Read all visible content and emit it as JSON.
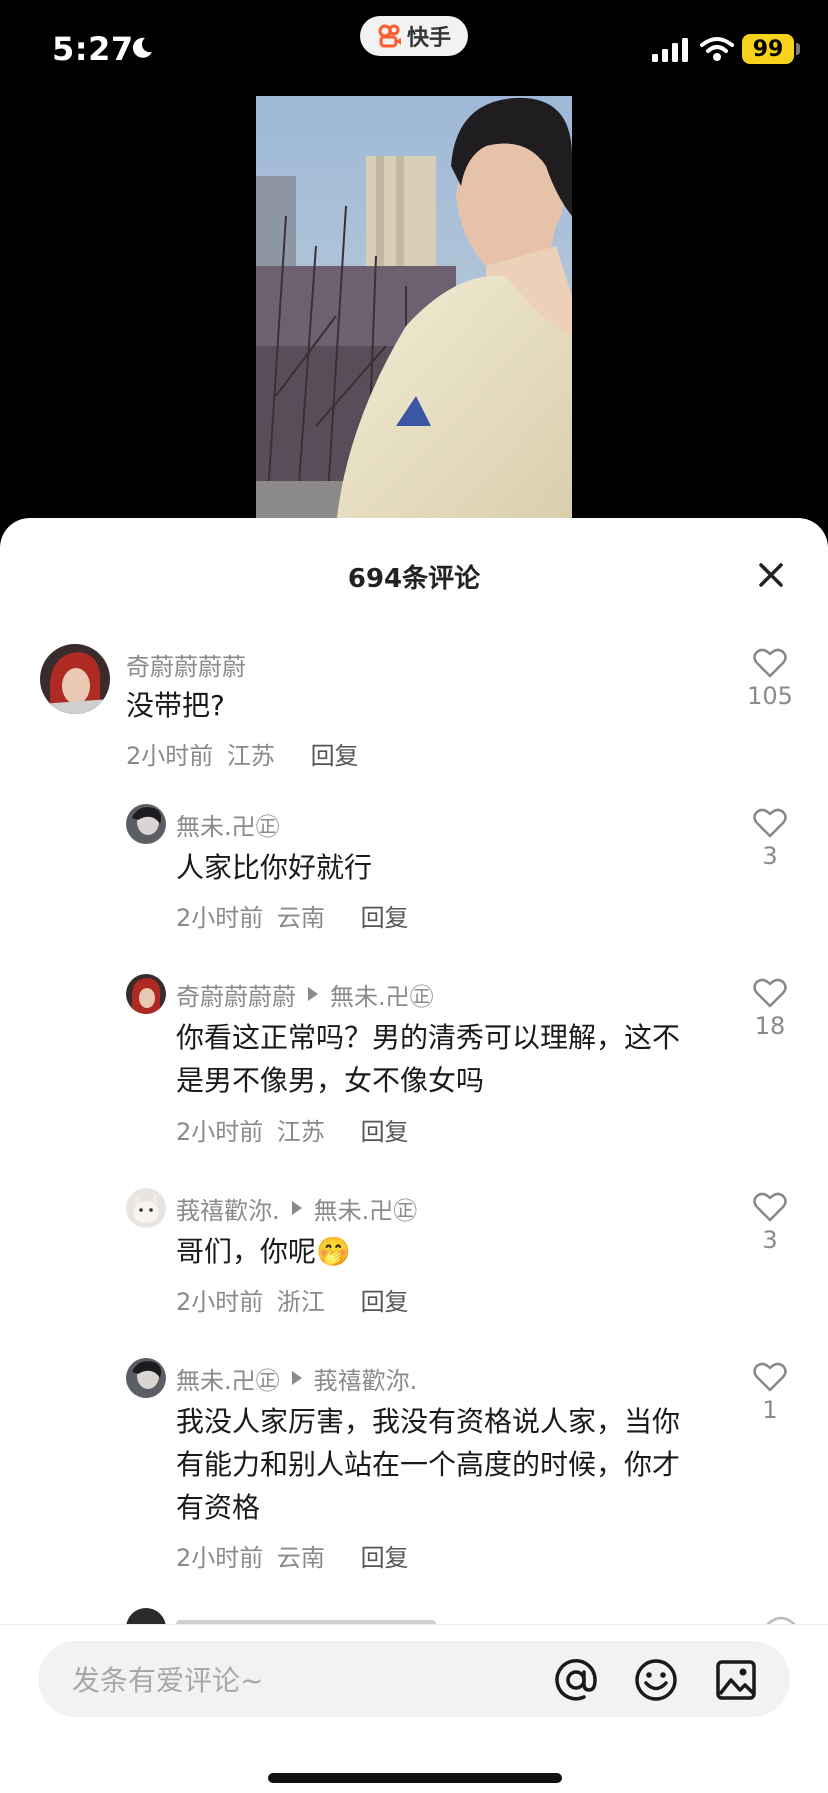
{
  "status_bar": {
    "time": "5:27",
    "app_name": "快手",
    "battery": "99"
  },
  "comments_sheet": {
    "title": "694条评论",
    "input_placeholder": "发条有爱评论~"
  },
  "comments": [
    {
      "user": "奇蔚蔚蔚蔚",
      "text": "没带把?",
      "time": "2小时前",
      "location": "江苏",
      "reply_label": "回复",
      "likes": "105"
    },
    {
      "user": "無未.卍㊣",
      "text": "人家比你好就行",
      "time": "2小时前",
      "location": "云南",
      "reply_label": "回复",
      "likes": "3"
    },
    {
      "user": "奇蔚蔚蔚蔚",
      "reply_to": "無未.卍㊣",
      "text": "你看这正常吗？男的清秀可以理解，这不是男不像男，女不像女吗",
      "time": "2小时前",
      "location": "江苏",
      "reply_label": "回复",
      "likes": "18"
    },
    {
      "user": "莪禧歡沵.",
      "reply_to": "無未.卍㊣",
      "text": "哥们，你呢🤭",
      "time": "2小时前",
      "location": "浙江",
      "reply_label": "回复",
      "likes": "3"
    },
    {
      "user": "無未.卍㊣",
      "reply_to": "莪禧歡沵.",
      "text": "我没人家厉害，我没有资格说人家，当你有能力和别人站在一个高度的时候，你才有资格",
      "time": "2小时前",
      "location": "云南",
      "reply_label": "回复",
      "likes": "1"
    }
  ],
  "colors": {
    "battery": "#f6d21a",
    "app_brand": "#ff5a2d",
    "muted_text": "#8a8a8a"
  },
  "icons": [
    "moon-icon",
    "kuaishou-logo-icon",
    "signal-icon",
    "wifi-icon",
    "close-icon",
    "heart-icon",
    "at-icon",
    "emoji-icon",
    "image-icon"
  ]
}
